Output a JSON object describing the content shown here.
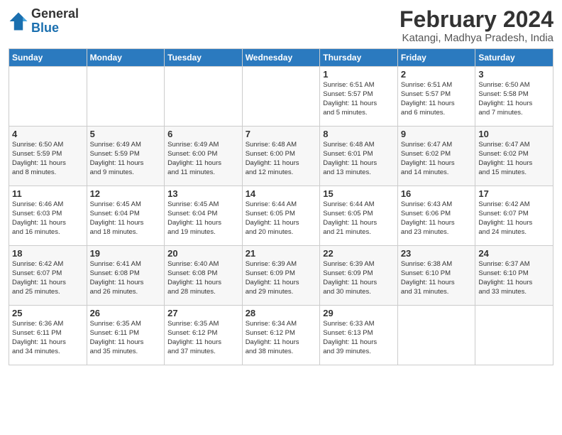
{
  "header": {
    "logo_general": "General",
    "logo_blue": "Blue",
    "month_year": "February 2024",
    "location": "Katangi, Madhya Pradesh, India"
  },
  "weekdays": [
    "Sunday",
    "Monday",
    "Tuesday",
    "Wednesday",
    "Thursday",
    "Friday",
    "Saturday"
  ],
  "weeks": [
    [
      {
        "day": "",
        "detail": ""
      },
      {
        "day": "",
        "detail": ""
      },
      {
        "day": "",
        "detail": ""
      },
      {
        "day": "",
        "detail": ""
      },
      {
        "day": "1",
        "detail": "Sunrise: 6:51 AM\nSunset: 5:57 PM\nDaylight: 11 hours\nand 5 minutes."
      },
      {
        "day": "2",
        "detail": "Sunrise: 6:51 AM\nSunset: 5:57 PM\nDaylight: 11 hours\nand 6 minutes."
      },
      {
        "day": "3",
        "detail": "Sunrise: 6:50 AM\nSunset: 5:58 PM\nDaylight: 11 hours\nand 7 minutes."
      }
    ],
    [
      {
        "day": "4",
        "detail": "Sunrise: 6:50 AM\nSunset: 5:59 PM\nDaylight: 11 hours\nand 8 minutes."
      },
      {
        "day": "5",
        "detail": "Sunrise: 6:49 AM\nSunset: 5:59 PM\nDaylight: 11 hours\nand 9 minutes."
      },
      {
        "day": "6",
        "detail": "Sunrise: 6:49 AM\nSunset: 6:00 PM\nDaylight: 11 hours\nand 11 minutes."
      },
      {
        "day": "7",
        "detail": "Sunrise: 6:48 AM\nSunset: 6:00 PM\nDaylight: 11 hours\nand 12 minutes."
      },
      {
        "day": "8",
        "detail": "Sunrise: 6:48 AM\nSunset: 6:01 PM\nDaylight: 11 hours\nand 13 minutes."
      },
      {
        "day": "9",
        "detail": "Sunrise: 6:47 AM\nSunset: 6:02 PM\nDaylight: 11 hours\nand 14 minutes."
      },
      {
        "day": "10",
        "detail": "Sunrise: 6:47 AM\nSunset: 6:02 PM\nDaylight: 11 hours\nand 15 minutes."
      }
    ],
    [
      {
        "day": "11",
        "detail": "Sunrise: 6:46 AM\nSunset: 6:03 PM\nDaylight: 11 hours\nand 16 minutes."
      },
      {
        "day": "12",
        "detail": "Sunrise: 6:45 AM\nSunset: 6:04 PM\nDaylight: 11 hours\nand 18 minutes."
      },
      {
        "day": "13",
        "detail": "Sunrise: 6:45 AM\nSunset: 6:04 PM\nDaylight: 11 hours\nand 19 minutes."
      },
      {
        "day": "14",
        "detail": "Sunrise: 6:44 AM\nSunset: 6:05 PM\nDaylight: 11 hours\nand 20 minutes."
      },
      {
        "day": "15",
        "detail": "Sunrise: 6:44 AM\nSunset: 6:05 PM\nDaylight: 11 hours\nand 21 minutes."
      },
      {
        "day": "16",
        "detail": "Sunrise: 6:43 AM\nSunset: 6:06 PM\nDaylight: 11 hours\nand 23 minutes."
      },
      {
        "day": "17",
        "detail": "Sunrise: 6:42 AM\nSunset: 6:07 PM\nDaylight: 11 hours\nand 24 minutes."
      }
    ],
    [
      {
        "day": "18",
        "detail": "Sunrise: 6:42 AM\nSunset: 6:07 PM\nDaylight: 11 hours\nand 25 minutes."
      },
      {
        "day": "19",
        "detail": "Sunrise: 6:41 AM\nSunset: 6:08 PM\nDaylight: 11 hours\nand 26 minutes."
      },
      {
        "day": "20",
        "detail": "Sunrise: 6:40 AM\nSunset: 6:08 PM\nDaylight: 11 hours\nand 28 minutes."
      },
      {
        "day": "21",
        "detail": "Sunrise: 6:39 AM\nSunset: 6:09 PM\nDaylight: 11 hours\nand 29 minutes."
      },
      {
        "day": "22",
        "detail": "Sunrise: 6:39 AM\nSunset: 6:09 PM\nDaylight: 11 hours\nand 30 minutes."
      },
      {
        "day": "23",
        "detail": "Sunrise: 6:38 AM\nSunset: 6:10 PM\nDaylight: 11 hours\nand 31 minutes."
      },
      {
        "day": "24",
        "detail": "Sunrise: 6:37 AM\nSunset: 6:10 PM\nDaylight: 11 hours\nand 33 minutes."
      }
    ],
    [
      {
        "day": "25",
        "detail": "Sunrise: 6:36 AM\nSunset: 6:11 PM\nDaylight: 11 hours\nand 34 minutes."
      },
      {
        "day": "26",
        "detail": "Sunrise: 6:35 AM\nSunset: 6:11 PM\nDaylight: 11 hours\nand 35 minutes."
      },
      {
        "day": "27",
        "detail": "Sunrise: 6:35 AM\nSunset: 6:12 PM\nDaylight: 11 hours\nand 37 minutes."
      },
      {
        "day": "28",
        "detail": "Sunrise: 6:34 AM\nSunset: 6:12 PM\nDaylight: 11 hours\nand 38 minutes."
      },
      {
        "day": "29",
        "detail": "Sunrise: 6:33 AM\nSunset: 6:13 PM\nDaylight: 11 hours\nand 39 minutes."
      },
      {
        "day": "",
        "detail": ""
      },
      {
        "day": "",
        "detail": ""
      }
    ]
  ]
}
